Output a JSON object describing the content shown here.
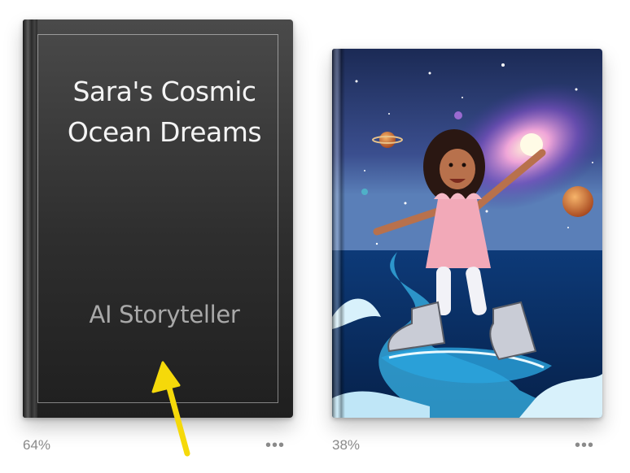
{
  "library": {
    "books": [
      {
        "title": "Sara's Cosmic Ocean Dreams",
        "title_line1": "Sara's Cosmic",
        "title_line2": "Ocean Dreams",
        "author": "AI Storyteller",
        "progress": "64%",
        "progress_value": 0.64,
        "more_label": "•••"
      },
      {
        "cover_description_icon": "illustrated-cover",
        "progress": "38%",
        "progress_value": 0.38,
        "more_label": "•••"
      }
    ]
  },
  "colors": {
    "annotation_arrow": "#f5d90a",
    "progress_text": "#8a8a8a",
    "cover_dark": "#2e2e2e"
  }
}
